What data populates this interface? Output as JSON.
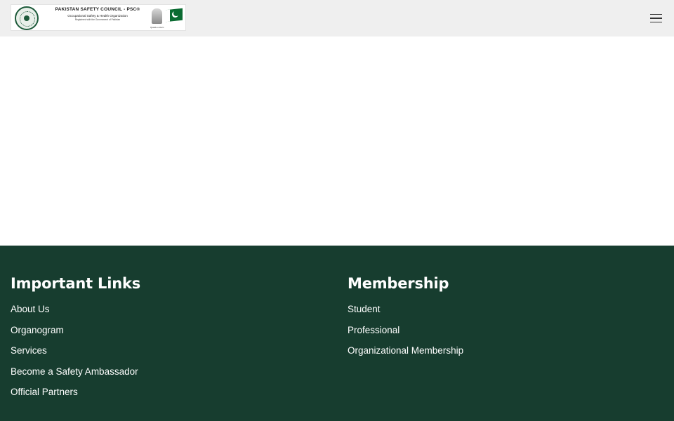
{
  "header": {
    "logo": {
      "title": "PAKISTAN SAFETY COUNCIL - PSC®",
      "subtitle": "Occupational Safety & Health Organization",
      "tagline": "Registered with the Government of Pakistan",
      "caption": "Quaid-e-Azam"
    },
    "menu_icon": "hamburger-menu-icon"
  },
  "footer": {
    "background": "#173d2f",
    "important_links": {
      "heading": "Important Links",
      "items": [
        {
          "label": "About Us"
        },
        {
          "label": "Organogram"
        },
        {
          "label": "Services"
        },
        {
          "label": "Become a Safety Ambassador"
        },
        {
          "label": "Official Partners"
        }
      ]
    },
    "membership": {
      "heading": "Membership",
      "items": [
        {
          "label": "Student"
        },
        {
          "label": "Professional"
        },
        {
          "label": "Organizational Membership"
        }
      ]
    }
  }
}
